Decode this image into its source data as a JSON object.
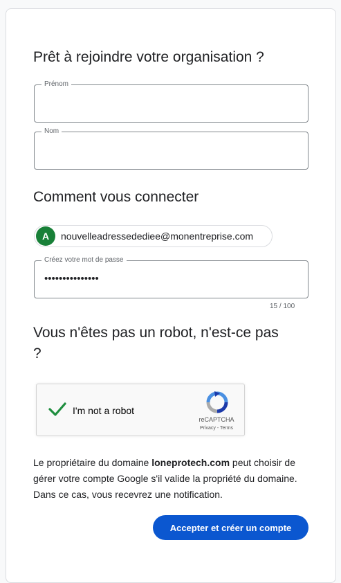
{
  "form": {
    "title": "Prêt à rejoindre votre organisation ?",
    "first_name_label": "Prénom",
    "first_name_value": "",
    "last_name_label": "Nom",
    "last_name_value": ""
  },
  "sign_in": {
    "title": "Comment vous connecter",
    "account_initial": "A",
    "account_email": "nouvelleadressedediee@monentreprise.com",
    "password_label": "Créez votre mot de passe",
    "password_masked": "•••••••••••••••",
    "password_counter": "15 / 100"
  },
  "robot_check": {
    "title": "Vous n'êtes pas un robot, n'est-ce pas ?",
    "checkbox_label": "I'm not a robot",
    "checked": true,
    "brand": "reCAPTCHA",
    "privacy_link": "Privacy",
    "separator": " - ",
    "terms_link": "Terms"
  },
  "notice": {
    "text_before": "Le propriétaire du domaine ",
    "domain": "loneprotech.com",
    "text_after": " peut choisir de gérer votre compte Google s'il valide la propriété du domaine. Dans ce cas, vous recevrez une notification."
  },
  "actions": {
    "submit_label": "Accepter et créer un compte"
  },
  "colors": {
    "primary_button": "#0b57d0",
    "avatar_bg": "#188038",
    "checkmark": "#1e8e3e"
  },
  "icons": {
    "check": "check-icon",
    "recaptcha": "recaptcha-logo-icon"
  }
}
